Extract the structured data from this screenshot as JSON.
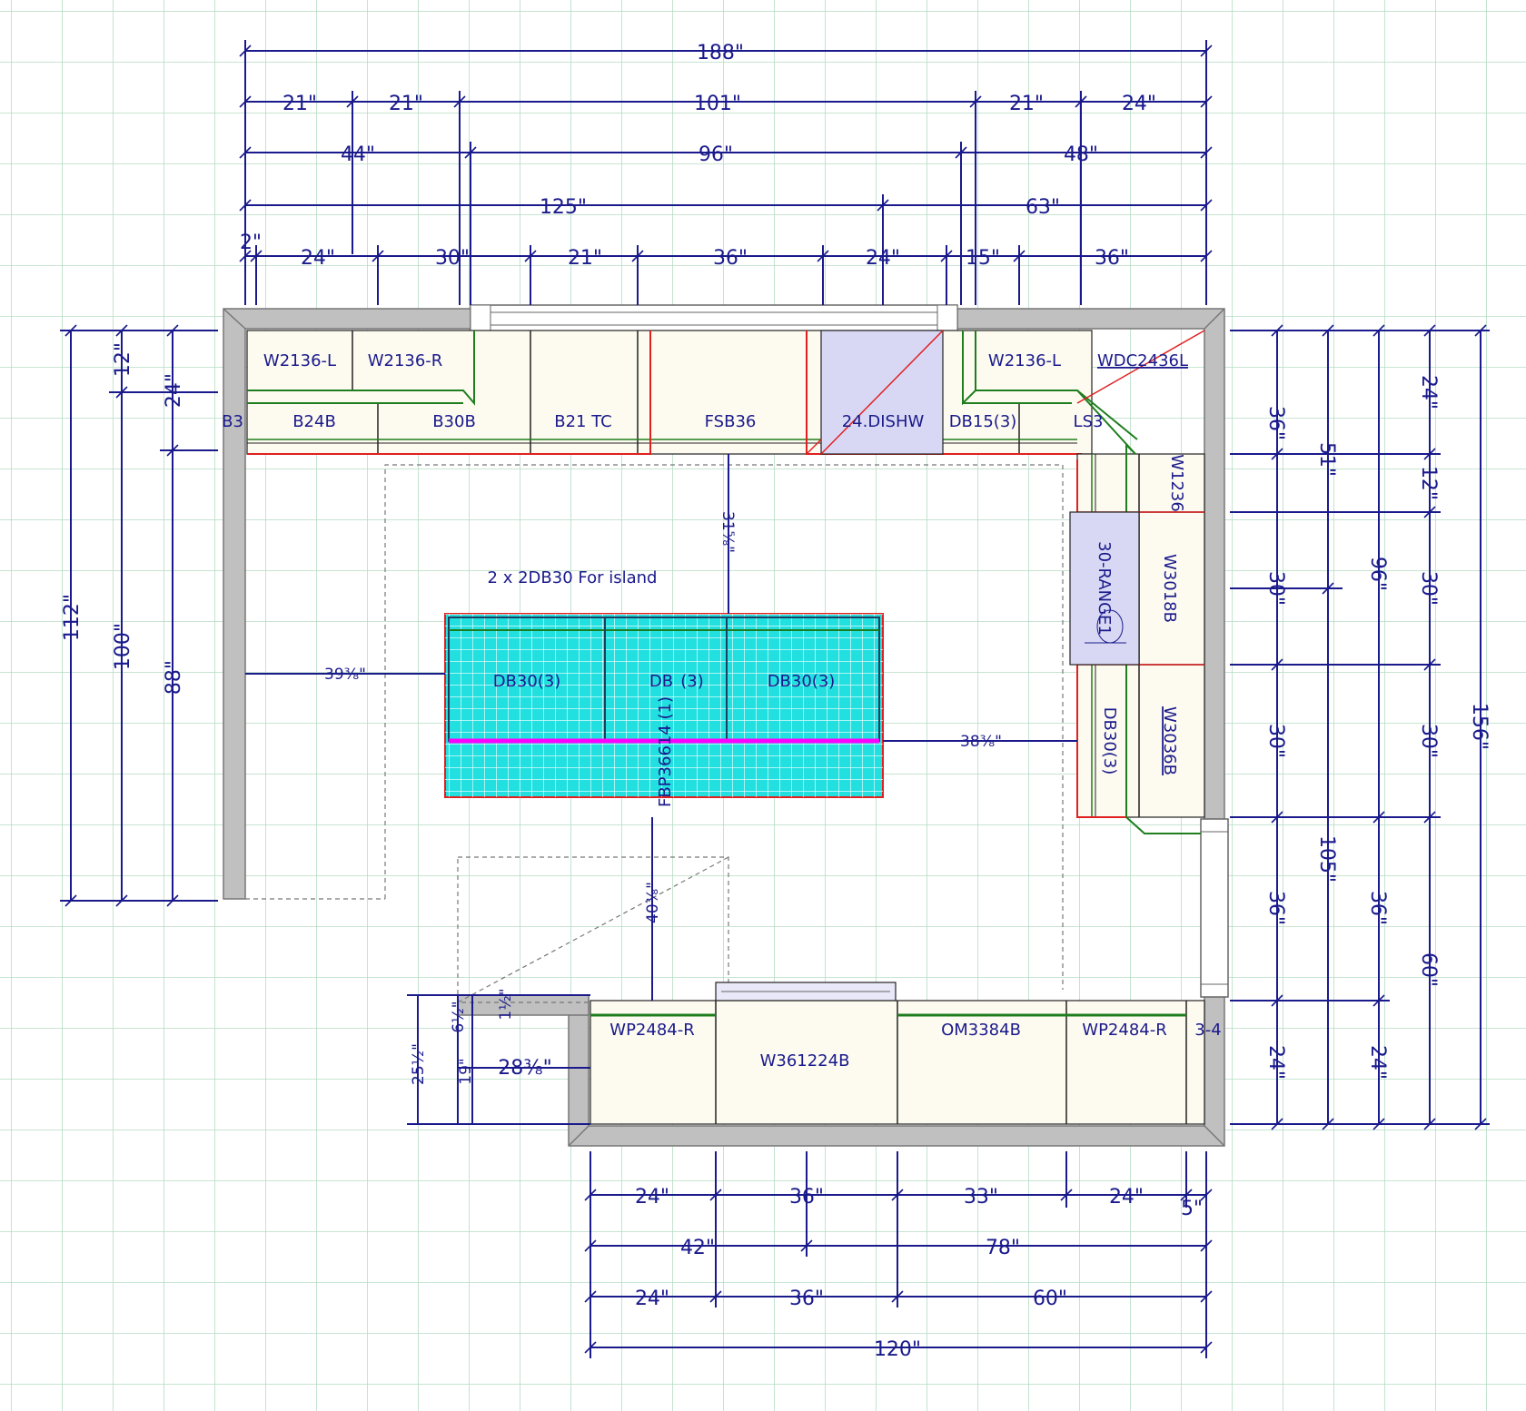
{
  "dimensions": {
    "top_overall": "188\"",
    "top_r1": [
      "21\"",
      "21\"",
      "101\"",
      "21\"",
      "24\""
    ],
    "top_r2": [
      "44\"",
      "96\"",
      "48\""
    ],
    "top_r3": [
      "125\"",
      "63\""
    ],
    "top_r4": [
      "2\"",
      "24\"",
      "30\"",
      "21\"",
      "36\"",
      "24\"",
      "15\"",
      "36\""
    ],
    "left": [
      "112\"",
      "100\"",
      "88\"",
      "12\"",
      "24\""
    ],
    "right_a": [
      "36\"",
      "30\"",
      "30\"",
      "36\"",
      "24\""
    ],
    "right_b": [
      "51\"",
      "105\""
    ],
    "right_c": [
      "96\"",
      "36\"",
      "24\""
    ],
    "right_d": [
      "24\"",
      "12\"",
      "30\"",
      "30\"",
      "60\""
    ],
    "right_overall": "156\"",
    "bottom_r1": [
      "24\"",
      "36\"",
      "33\"",
      "24\"",
      "5\""
    ],
    "bottom_r2": [
      "42\"",
      "78\""
    ],
    "bottom_r3": [
      "24\"",
      "36\"",
      "60\""
    ],
    "bottom_overall": "120\"",
    "clearance_top": "31⅝\"",
    "clearance_left": "39⅜\"",
    "clearance_right": "38⅜\"",
    "clearance_bottom": "40⅜\"",
    "opening_dims": [
      "25½\"",
      "6½\"",
      "19\"",
      "1½\"",
      "28⅜\""
    ]
  },
  "cabinets": {
    "top_wall": [
      "W2136-L",
      "W2136-R",
      "W2136-L",
      "WDC2436L"
    ],
    "top_base": [
      "B3",
      "B24B",
      "B30B",
      "B21 TC",
      "FSB36",
      "24.DISHW",
      "DB15(3)",
      "LS3"
    ],
    "right": [
      "W1236",
      "30-RANGE1",
      "W3018B",
      "DB30(3)",
      "W3036B"
    ],
    "island": [
      "DB30(3)",
      "DB",
      "(3)",
      "DB30(3)",
      "FBP36614 (1)"
    ],
    "bottom": [
      "WP2484-R",
      "W361224B",
      "OM3384B",
      "WP2484-R",
      "3-4"
    ]
  },
  "notes": {
    "island_note": "2 x 2DB30 For island"
  },
  "colors": {
    "grid": "#b5dcc4",
    "dimension": "#1a1a8c",
    "wall": "#c0c0c0",
    "cabinet_fill": "#fdfbef",
    "appliance_fill": "#d8d8f4",
    "island_fill": "#22e0e0",
    "red_outline": "#e02020",
    "green_outline": "#1e7e1e",
    "magenta": "#ff00ff"
  }
}
